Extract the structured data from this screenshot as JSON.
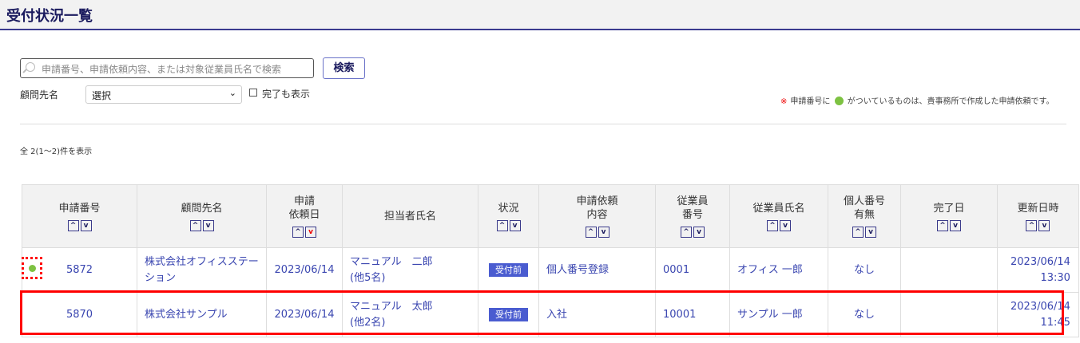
{
  "page_title": "受付状況一覧",
  "search": {
    "placeholder": "申請番号、申請依頼内容、または対象従業員氏名で検索",
    "button": "検索"
  },
  "filter": {
    "label": "顧問先名",
    "select_value": "選択",
    "checkbox_label": "完了も表示",
    "checked": false
  },
  "note": {
    "mark": "※",
    "before": "申請番号に",
    "after": "がついているものは、貴事務所で作成した申請依頼です。",
    "dot_color": "#7dc242"
  },
  "count": "全 2(1～2)件を表示",
  "columns": [
    {
      "label": [
        "申請番号"
      ],
      "sort": true
    },
    {
      "label": [
        "顧問先名"
      ],
      "sort": true
    },
    {
      "label": [
        "申請",
        "依頼日"
      ],
      "sort": true,
      "active": "desc"
    },
    {
      "label": [
        "担当者氏名"
      ],
      "sort": false
    },
    {
      "label": [
        "状況"
      ],
      "sort": true
    },
    {
      "label": [
        "申請依頼",
        "内容"
      ],
      "sort": true
    },
    {
      "label": [
        "従業員",
        "番号"
      ],
      "sort": true
    },
    {
      "label": [
        "従業員氏名"
      ],
      "sort": true
    },
    {
      "label": [
        "個人番号",
        "有無"
      ],
      "sort": true
    },
    {
      "label": [
        "完了日"
      ],
      "sort": true
    },
    {
      "label": [
        "更新日時"
      ],
      "sort": true
    }
  ],
  "rows": [
    {
      "id": "5872",
      "own": true,
      "client": "株式会社オフィスステーション",
      "date": "2023/06/14",
      "staff": "マニュアル　二郎",
      "staff_more": "(他5名)",
      "status": "受付前",
      "content": "個人番号登録",
      "emp_no": "0001",
      "emp_name": "オフィス 一郎",
      "mynumber": "なし",
      "done": "",
      "updated": "2023/06/14 13:30"
    },
    {
      "id": "5870",
      "own": false,
      "client": "株式会社サンプル",
      "date": "2023/06/14",
      "staff": "マニュアル　太郎",
      "staff_more": "(他2名)",
      "status": "受付前",
      "content": "入社",
      "emp_no": "10001",
      "emp_name": "サンプル 一郎",
      "mynumber": "なし",
      "done": "",
      "updated": "2023/06/14 11:45"
    }
  ]
}
